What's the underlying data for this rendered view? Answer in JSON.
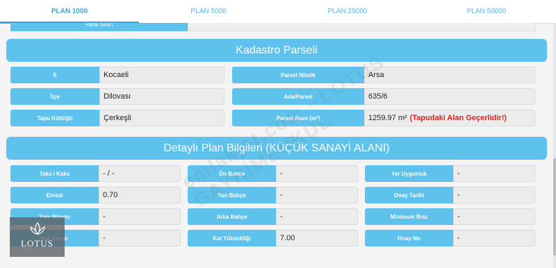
{
  "tabs": [
    {
      "label": "PLAN 1000",
      "active": true
    },
    {
      "label": "PLAN 5000",
      "active": false
    },
    {
      "label": "PLAN 25000",
      "active": false
    },
    {
      "label": "PLAN 50000",
      "active": false
    }
  ],
  "partial_row": {
    "label": "Pafta Sınırı"
  },
  "kadastro": {
    "title": "Kadastro Parseli",
    "left": [
      {
        "label": "İl",
        "value": "Kocaeli"
      },
      {
        "label": "İlçe",
        "value": "Dilovası"
      },
      {
        "label": "Tapu Kütlüğü",
        "value": "Çerkeşli"
      }
    ],
    "right": [
      {
        "label": "Parsel Nitelik",
        "value": "Arsa"
      },
      {
        "label": "Ada/Parsel",
        "value": "635/6"
      },
      {
        "label": "Parsel Alanı (m²)",
        "value": "1259.97 m²",
        "warning": "(Tapudaki Alan Geçerlidir!)"
      }
    ]
  },
  "detay": {
    "title": "Detaylı Plan Bilgileri (KÜÇÜK SANAYİ ALANI)",
    "col1": [
      {
        "label": "Taks / Kaks",
        "value": "- / -"
      },
      {
        "label": "Emsal",
        "value": "0.70"
      },
      {
        "label": "Yapı Nizamı",
        "value": "-"
      },
      {
        "label": "Kat Sayısı",
        "value": "-"
      }
    ],
    "col2": [
      {
        "label": "Ön Bahçe",
        "value": "-"
      },
      {
        "label": "Yan Bahçe",
        "value": "-"
      },
      {
        "label": "Arka Bahçe",
        "value": "-"
      },
      {
        "label": "Kat Yüksekliği",
        "value": "7.00"
      }
    ],
    "col3": [
      {
        "label": "Yer Uygunluk",
        "value": "-"
      },
      {
        "label": "Onay Tarihi",
        "value": "-"
      },
      {
        "label": "Minimum İfraz",
        "value": "-"
      },
      {
        "label": "Onay No",
        "value": "-"
      }
    ]
  },
  "watermark": {
    "text": "emlakjet.com · LOTUS GAYRİMENKUL"
  },
  "logo": {
    "text": "LOTUS"
  },
  "colors": {
    "accent": "#5ec2ec",
    "tab_text": "#58b9e6",
    "warning": "#d8251f"
  }
}
